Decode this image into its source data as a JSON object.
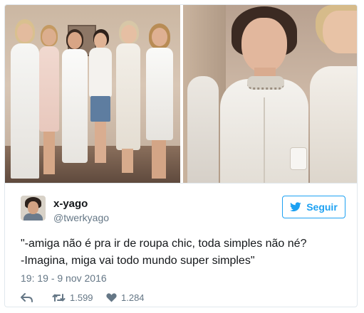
{
  "tweet": {
    "display_name": "x-yago",
    "handle": "@twerkyago",
    "follow_label": "Seguir",
    "text_lines": [
      "\"-amiga não é pra ir de roupa chic, toda simples não né?",
      "-Imagina, miga vai todo mundo super simples\""
    ],
    "timestamp": "19: 19 - 9 nov 2016",
    "retweet_count": "1.599",
    "like_count": "1.284"
  },
  "icons": {
    "follow": "bird-icon",
    "reply": "reply-icon",
    "retweet": "retweet-icon",
    "like": "heart-icon"
  },
  "colors": {
    "accent": "#1da1f2",
    "text": "#14171a",
    "muted": "#657786",
    "border": "#e1e8ed"
  }
}
